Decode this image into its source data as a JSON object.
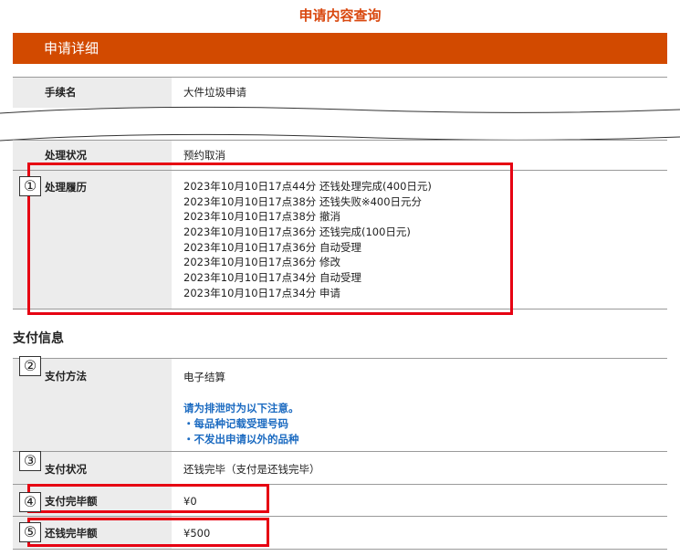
{
  "page_title": "申请内容查询",
  "detail_section": {
    "title": "申请详细",
    "procedure_name": {
      "label": "手续名",
      "value": "大件垃圾申请"
    },
    "processing_status": {
      "label": "处理状况",
      "value": "预约取消"
    },
    "processing_history": {
      "label": "处理履历",
      "entries": [
        "2023年10月10日17点44分 还钱处理完成(400日元)",
        "2023年10月10日17点38分 还钱失败※400日元分",
        "2023年10月10日17点38分 撤消",
        "2023年10月10日17点36分 还钱完成(100日元)",
        "2023年10月10日17点36分 自动受理",
        "2023年10月10日17点36分 修改",
        "2023年10月10日17点34分 自动受理",
        "2023年10月10日17点34分 申请"
      ]
    }
  },
  "payment_section": {
    "title": "支付信息",
    "method": {
      "label": "支付方法",
      "value": "电子结算",
      "note_lines": [
        "请为排泄时为以下注意。",
        "・每品种记载受理号码",
        "・不发出申请以外的品种"
      ]
    },
    "status": {
      "label": "支付状况",
      "value": "还钱完毕（支付是还钱完毕）"
    },
    "paid_amount": {
      "label": "支付完毕额",
      "value": "¥0"
    },
    "refund_amount": {
      "label": "还钱完毕额",
      "value": "¥500"
    }
  },
  "annotations": [
    "①",
    "②",
    "③",
    "④",
    "⑤"
  ],
  "colors": {
    "accent": "#d24a00",
    "title": "#d9480f",
    "highlight": "#e60012",
    "note": "#1c6bc1",
    "label_bg": "#ececec"
  }
}
